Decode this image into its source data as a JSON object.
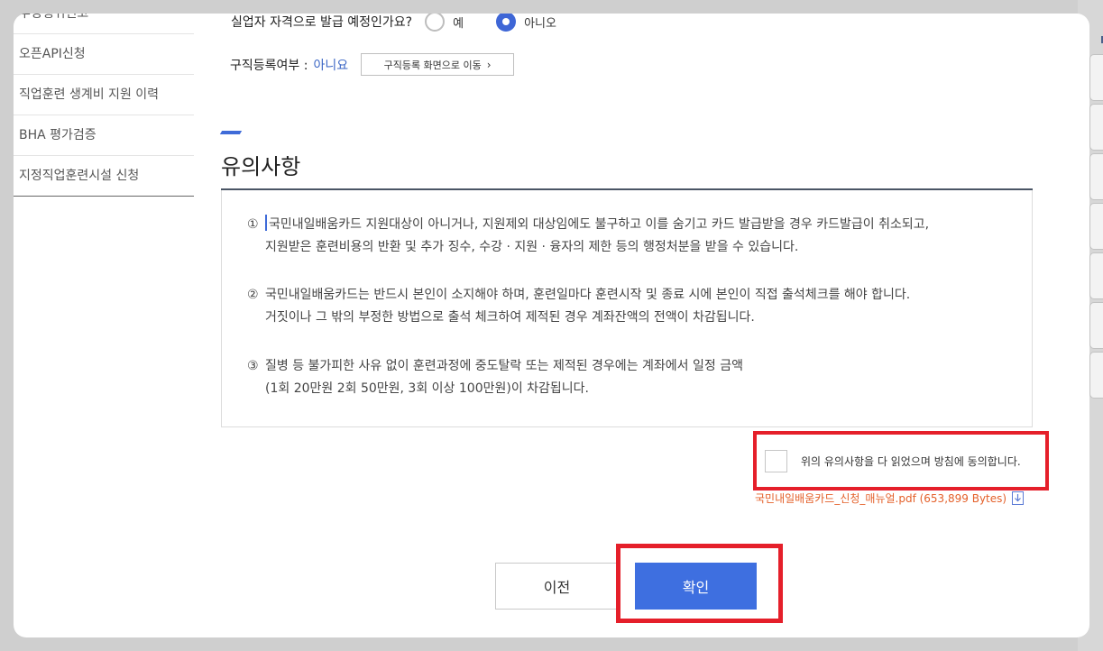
{
  "sidebar": {
    "items": [
      {
        "label": "부정행위신고"
      },
      {
        "label": "오픈API신청"
      },
      {
        "label": "직업훈련 생계비 지원 이력"
      },
      {
        "label": "BHA 평가검증"
      },
      {
        "label": "지정직업훈련시설 신청"
      }
    ]
  },
  "question": {
    "label": "실업자 자격으로 발급 예정인가요?",
    "options": [
      {
        "label": "예",
        "selected": false
      },
      {
        "label": "아니오",
        "selected": true
      }
    ]
  },
  "job_registration": {
    "label": "구직등록여부 :",
    "value": "아니요",
    "button_label": "구직등록 화면으로 이동"
  },
  "notice": {
    "title": "유의사항",
    "items": [
      {
        "num": "①",
        "lines": [
          "국민내일배움카드 지원대상이 아니거나, 지원제외 대상임에도 불구하고 이를 숨기고 카드 발급받을 경우 카드발급이 취소되고,",
          "지원받은 훈련비용의 반환 및 추가 징수, 수강 · 지원 · 융자의 제한 등의 행정처분을 받을 수 있습니다."
        ]
      },
      {
        "num": "②",
        "lines": [
          "국민내일배움카드는 반드시 본인이 소지해야 하며, 훈련일마다 훈련시작 및 종료 시에 본인이 직접 출석체크를 해야 합니다.",
          "거짓이나 그 밖의 부정한 방법으로 출석 체크하여 제적된 경우 계좌잔액의 전액이 차감됩니다."
        ]
      },
      {
        "num": "③",
        "lines": [
          "질병 등 불가피한 사유 없이 훈련과정에 중도탈락 또는 제적된 경우에는 계좌에서 일정 금액",
          "(1회 20만원 2회 50만원, 3회 이상 100만원)이 차감됩니다."
        ]
      }
    ]
  },
  "agreement": {
    "label": "위의 유의사항을 다 읽었으며 방침에 동의합니다.",
    "checked": false
  },
  "manual": {
    "link_text": "국민내일배움카드_신청_매뉴얼.pdf (653,899 Bytes)",
    "icon": "download-icon"
  },
  "buttons": {
    "prev_label": "이전",
    "confirm_label": "확인"
  },
  "colors": {
    "accent": "#3e6fe0",
    "highlight": "#e51f2a",
    "link": "#e4602a"
  }
}
